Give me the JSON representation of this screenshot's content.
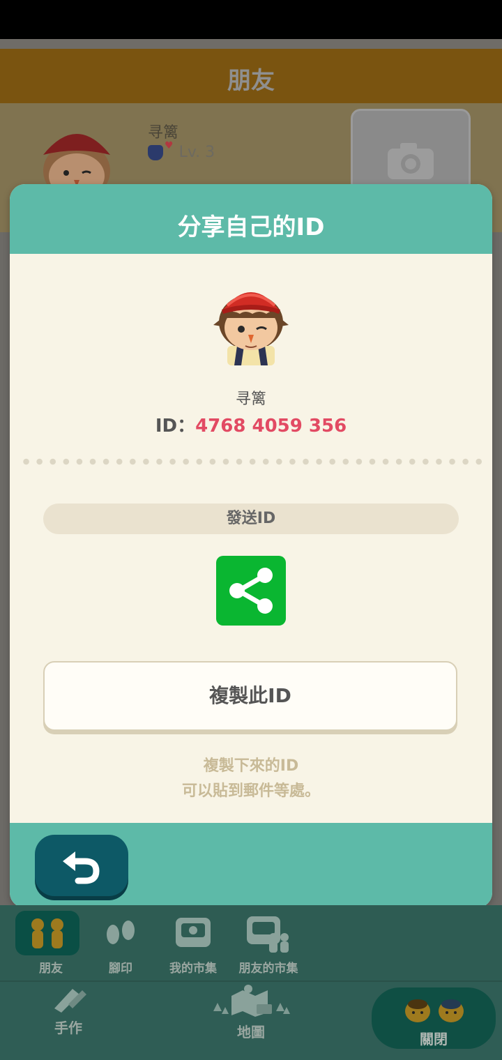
{
  "background": {
    "header_title": "朋友",
    "profile_name": "寻篱",
    "profile_level": "Lv. 3"
  },
  "modal": {
    "title": "分享自己的ID",
    "player_name": "寻篱",
    "id_label": "ID：",
    "id_value": "4768 4059 356",
    "send_label": "發送ID",
    "copy_label": "複製此ID",
    "hint_line1": "複製下來的ID",
    "hint_line2": "可以貼到郵件等處。"
  },
  "subnav": {
    "items": [
      {
        "label": "朋友",
        "icon": "friends-icon"
      },
      {
        "label": "腳印",
        "icon": "footprint-icon"
      },
      {
        "label": "我的市集",
        "icon": "my-market-icon"
      },
      {
        "label": "朋友的市集",
        "icon": "friends-market-icon"
      }
    ]
  },
  "mainnav": {
    "craft_label": "手作",
    "map_label": "地圖",
    "close_label": "關閉"
  },
  "colors": {
    "teal": "#5dbaa8",
    "id_red": "#e24a63",
    "share_green": "#0ab631",
    "back_dark": "#0d5966"
  }
}
